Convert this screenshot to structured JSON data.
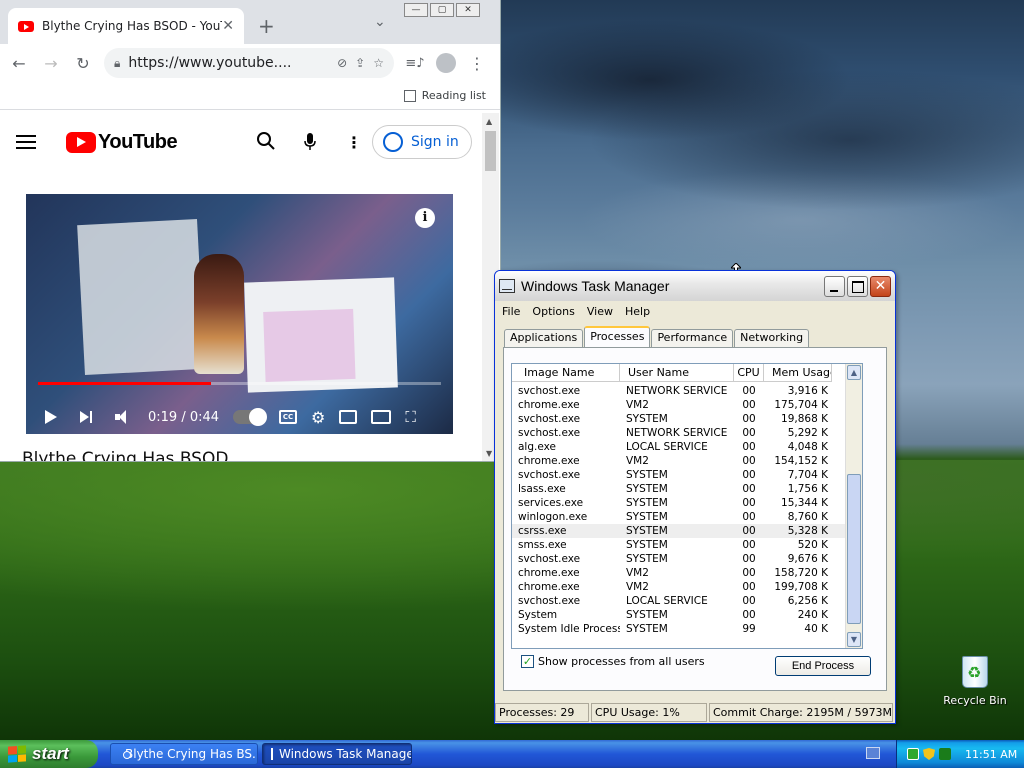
{
  "browser": {
    "tab_title": "Blythe Crying Has BSOD - YouTube",
    "tab_close": "✕",
    "new_tab": "+",
    "tab_search": "⌄",
    "url": "https://www.youtube....",
    "reading_list": "Reading list",
    "youtube": {
      "logo_text": "YouTube",
      "sign_in": "Sign in",
      "player_time": "0:19 / 0:44",
      "progress": 0.43,
      "video_title_peek": "Blythe Crying Has BSOD",
      "info": "i",
      "cc": "CC"
    }
  },
  "taskmgr": {
    "title": "Windows Task Manager",
    "menu": [
      "File",
      "Options",
      "View",
      "Help"
    ],
    "tabs": [
      "Applications",
      "Processes",
      "Performance",
      "Networking"
    ],
    "active_tab": "Processes",
    "columns": [
      "Image Name",
      "User Name",
      "CPU",
      "Mem Usage"
    ],
    "processes": [
      {
        "name": "svchost.exe",
        "user": "NETWORK SERVICE",
        "cpu": "00",
        "mem": "3,916 K"
      },
      {
        "name": "chrome.exe",
        "user": "VM2",
        "cpu": "00",
        "mem": "175,704 K"
      },
      {
        "name": "svchost.exe",
        "user": "SYSTEM",
        "cpu": "00",
        "mem": "19,868 K"
      },
      {
        "name": "svchost.exe",
        "user": "NETWORK SERVICE",
        "cpu": "00",
        "mem": "5,292 K"
      },
      {
        "name": "alg.exe",
        "user": "LOCAL SERVICE",
        "cpu": "00",
        "mem": "4,048 K"
      },
      {
        "name": "chrome.exe",
        "user": "VM2",
        "cpu": "00",
        "mem": "154,152 K"
      },
      {
        "name": "svchost.exe",
        "user": "SYSTEM",
        "cpu": "00",
        "mem": "7,704 K"
      },
      {
        "name": "lsass.exe",
        "user": "SYSTEM",
        "cpu": "00",
        "mem": "1,756 K"
      },
      {
        "name": "services.exe",
        "user": "SYSTEM",
        "cpu": "00",
        "mem": "15,344 K"
      },
      {
        "name": "winlogon.exe",
        "user": "SYSTEM",
        "cpu": "00",
        "mem": "8,760 K"
      },
      {
        "name": "csrss.exe",
        "user": "SYSTEM",
        "cpu": "00",
        "mem": "5,328 K"
      },
      {
        "name": "smss.exe",
        "user": "SYSTEM",
        "cpu": "00",
        "mem": "520 K"
      },
      {
        "name": "svchost.exe",
        "user": "SYSTEM",
        "cpu": "00",
        "mem": "9,676 K"
      },
      {
        "name": "chrome.exe",
        "user": "VM2",
        "cpu": "00",
        "mem": "158,720 K"
      },
      {
        "name": "chrome.exe",
        "user": "VM2",
        "cpu": "00",
        "mem": "199,708 K"
      },
      {
        "name": "svchost.exe",
        "user": "LOCAL SERVICE",
        "cpu": "00",
        "mem": "6,256 K"
      },
      {
        "name": "System",
        "user": "SYSTEM",
        "cpu": "00",
        "mem": "240 K"
      },
      {
        "name": "System Idle Process",
        "user": "SYSTEM",
        "cpu": "99",
        "mem": "40 K"
      }
    ],
    "selected_index": 10,
    "show_all_label": "Show processes from all users",
    "show_all_checked": "✓",
    "end_process": "End Process",
    "status": {
      "processes": "Processes: 29",
      "cpu": "CPU Usage: 1%",
      "commit": "Commit Charge: 2195M / 5973M"
    }
  },
  "desktop": {
    "recycle_bin": "Recycle Bin"
  },
  "taskbar": {
    "start": "start",
    "tasks": [
      "Blythe Crying Has BS...",
      "Windows Task Manager"
    ],
    "clock": "11:51 AM"
  }
}
